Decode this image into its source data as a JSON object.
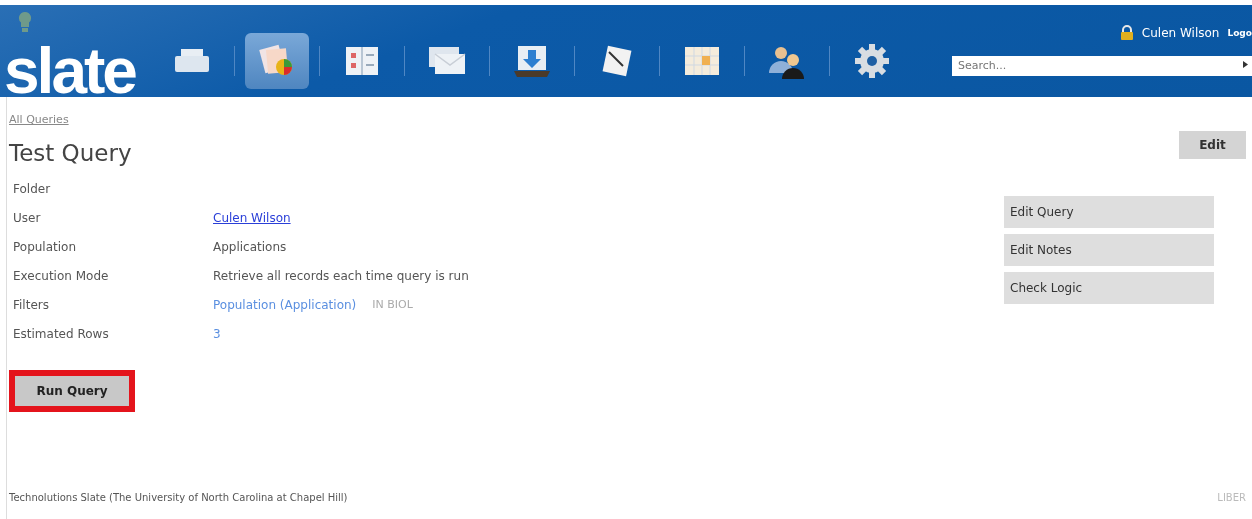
{
  "header": {
    "logo": "slate",
    "user": "Culen Wilson",
    "logout": "Logo",
    "search": {
      "placeholder": "Search..."
    },
    "nav": [
      {
        "kind": "printer",
        "selected": false
      },
      {
        "kind": "cards",
        "selected": true
      },
      {
        "kind": "form",
        "selected": false
      },
      {
        "kind": "envelope",
        "selected": false
      },
      {
        "kind": "download",
        "selected": false
      },
      {
        "kind": "paper",
        "selected": false
      },
      {
        "kind": "calendar",
        "selected": false
      },
      {
        "kind": "people",
        "selected": false
      },
      {
        "kind": "gear",
        "selected": false
      }
    ]
  },
  "breadcrumb": "All Queries",
  "title": "Test Query",
  "edit_button": "Edit",
  "details": [
    {
      "label": "Folder"
    },
    {
      "label": "User",
      "kind": "link",
      "value": "Culen Wilson"
    },
    {
      "label": "Population",
      "kind": "text",
      "value": "Applications"
    },
    {
      "label": "Execution Mode",
      "kind": "text",
      "value": "Retrieve all records each time query is run"
    },
    {
      "label": "Filters",
      "kind": "filter",
      "value": "Population (Application)",
      "extra": "IN BIOL"
    },
    {
      "label": "Estimated Rows",
      "kind": "count",
      "value": "3"
    }
  ],
  "actions": [
    "Edit Query",
    "Edit Notes",
    "Check Logic"
  ],
  "run_button": {
    "label": "Run Query",
    "highlighted": true
  },
  "footer": {
    "text": "Technolutions Slate (The University of North Carolina at Chapel Hill)",
    "right": "LIBER"
  }
}
